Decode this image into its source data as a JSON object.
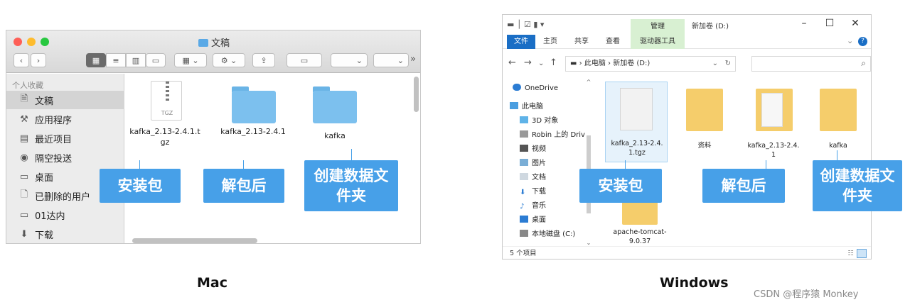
{
  "mac": {
    "window_title": "文稿",
    "colors": {
      "close": "#fe5f57",
      "minimize": "#febc2e",
      "zoom": "#28c840",
      "callout": "#47a0e8"
    },
    "toolbar": {
      "back_icon": "chevron-left-icon",
      "forward_icon": "chevron-right-icon",
      "gear_caret": "⚙ ⌄",
      "more": "»"
    },
    "sidebar": {
      "header": "个人收藏",
      "items": [
        {
          "label": "文稿",
          "icon": "document-icon",
          "selected": true
        },
        {
          "label": "应用程序",
          "icon": "apps-icon"
        },
        {
          "label": "最近项目",
          "icon": "recents-icon"
        },
        {
          "label": "隔空投送",
          "icon": "airdrop-icon"
        },
        {
          "label": "桌面",
          "icon": "desktop-icon"
        },
        {
          "label": "已删除的用户",
          "icon": "file-icon"
        },
        {
          "label": "01达内",
          "icon": "folder-icon"
        },
        {
          "label": "下载",
          "icon": "download-icon"
        }
      ]
    },
    "files": [
      {
        "name_line1": "kafka_2.13-2.4.1.t",
        "name_line2": "gz",
        "type": "tgz",
        "icon_label": "TGZ"
      },
      {
        "name_line1": "kafka_2.13-2.4.1",
        "name_line2": "",
        "type": "folder"
      },
      {
        "name_line1": "kafka",
        "name_line2": "",
        "type": "folder"
      }
    ],
    "callouts": [
      "安装包",
      "解包后",
      "创建数据文",
      "件夹"
    ],
    "caption": "Mac"
  },
  "windows": {
    "ribbon_context_group": "管理",
    "window_caption": "新加卷 (D:)",
    "ribbon_tabs": [
      "文件",
      "主页",
      "共享",
      "查看",
      "驱动器工具"
    ],
    "address": {
      "parts": [
        "此电脑",
        "新加卷 (D:)"
      ],
      "separator": "›"
    },
    "nav_items": [
      {
        "label": "OneDrive",
        "icon": "cloud-icon"
      },
      {
        "label": "此电脑",
        "icon": "computer-icon"
      },
      {
        "label": "3D 对象",
        "icon": "cube-icon"
      },
      {
        "label": "Robin 上的 Driv",
        "icon": "drive-icon"
      },
      {
        "label": "视频",
        "icon": "video-icon"
      },
      {
        "label": "图片",
        "icon": "image-icon"
      },
      {
        "label": "文档",
        "icon": "document-icon"
      },
      {
        "label": "下载",
        "icon": "download-icon"
      },
      {
        "label": "音乐",
        "icon": "music-icon"
      },
      {
        "label": "桌面",
        "icon": "desktop-icon"
      },
      {
        "label": "本地磁盘 (C:)",
        "icon": "disk-icon"
      }
    ],
    "files": [
      {
        "name_line1": "kafka_2.13-2.4.",
        "name_line2": "1.tgz",
        "type": "file",
        "selected": true
      },
      {
        "name_line1": "资料",
        "name_line2": "",
        "type": "folder"
      },
      {
        "name_line1": "kafka_2.13-2.4.",
        "name_line2": "1",
        "type": "folder"
      },
      {
        "name_line1": "kafka",
        "name_line2": "",
        "type": "folder"
      },
      {
        "name_line1": "apache-tomcat-",
        "name_line2": "9.0.37",
        "type": "folder"
      }
    ],
    "status": "5 个项目",
    "callouts": [
      "安装包",
      "解包后",
      "创建数据文",
      "件夹"
    ],
    "caption": "Windows"
  },
  "watermark": "CSDN @程序猿 Monkey"
}
